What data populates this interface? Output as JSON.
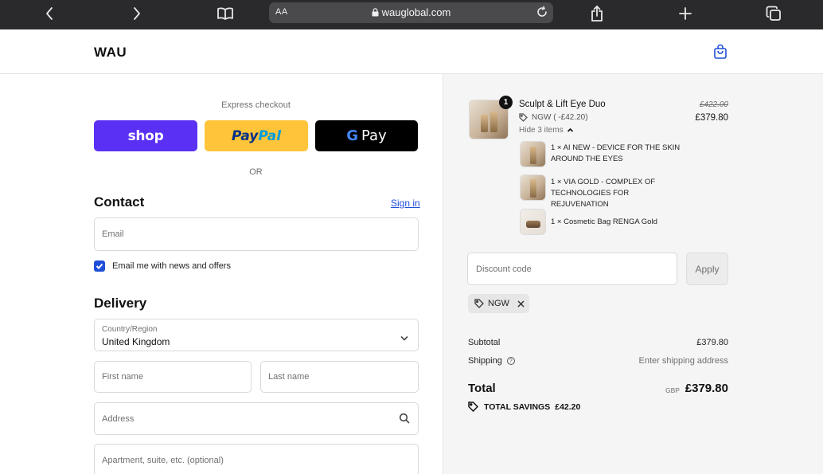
{
  "browser": {
    "aa_label": "AA",
    "url_host": "wauglobal.com"
  },
  "site": {
    "logo": "WAU"
  },
  "checkout": {
    "express_label": "Express checkout",
    "shop_label": "shop",
    "paypal_part1": "Pay",
    "paypal_part2": "Pal",
    "gpay_g": "G",
    "gpay_label": "Pay",
    "or_label": "OR",
    "contact_title": "Contact",
    "signin_label": "Sign in",
    "email_placeholder": "Email",
    "newsletter_label": "Email me with news and offers",
    "newsletter_checked": true,
    "delivery_title": "Delivery",
    "country_label": "Country/Region",
    "country_value": "United Kingdom",
    "first_name_placeholder": "First name",
    "last_name_placeholder": "Last name",
    "address_placeholder": "Address",
    "apartment_placeholder": "Apartment, suite, etc. (optional)"
  },
  "order": {
    "product": {
      "quantity": "1",
      "name": "Sculpt & Lift Eye Duo",
      "discount": "NGW ( -£42.20)",
      "original_price": "£422.00",
      "price": "£379.80",
      "toggle_label": "Hide 3 items",
      "items": [
        {
          "text": "1 × AI NEW - DEVICE FOR THE SKIN AROUND THE EYES"
        },
        {
          "text": "1 × VIA GOLD - COMPLEX OF TECHNOLOGIES FOR REJUVENATION"
        },
        {
          "text": "1 × Cosmetic Bag RENGA Gold"
        }
      ]
    },
    "discount_placeholder": "Discount code",
    "apply_label": "Apply",
    "applied_code": "NGW",
    "subtotal_label": "Subtotal",
    "subtotal_value": "£379.80",
    "shipping_label": "Shipping",
    "shipping_value": "Enter shipping address",
    "total_label": "Total",
    "currency": "GBP",
    "total_value": "£379.80",
    "savings_label": "TOTAL SAVINGS",
    "savings_value": "£42.20"
  },
  "colors": {
    "accent": "#1f4fd8",
    "shop_purple": "#5a31f4",
    "paypal_yellow": "#ffc439",
    "summary_bg": "#f5f5f5"
  }
}
